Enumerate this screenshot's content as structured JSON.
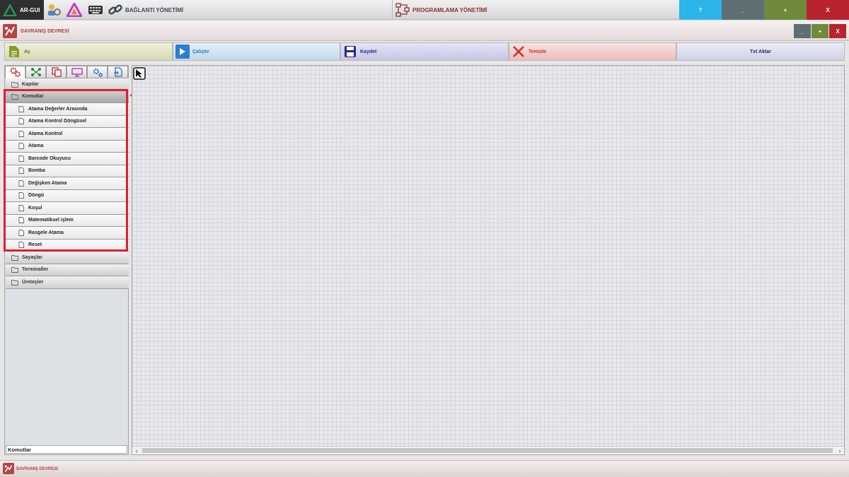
{
  "topbar": {
    "logo_text": "AR-GUI",
    "connection_label": "BAĞLANTI YÖNETİMİ",
    "programming_label": "PROGRAMLAMA YÖNETİMİ",
    "help_label": "?",
    "minimize_label": "_",
    "maximize_label": "+",
    "close_label": "X"
  },
  "subwindow": {
    "title": "DAVRANIŞ DEVRESİ",
    "minimize_label": "_",
    "maximize_label": "+",
    "close_label": "X"
  },
  "toolbar": {
    "open_label": "Aç",
    "run_label": "Çalıştır",
    "save_label": "Kaydet",
    "clear_label": "Temizle",
    "export_label": "Txt Aktar"
  },
  "tree": {
    "folders_before": [
      "Kapılar"
    ],
    "open_folder": "Komutlar",
    "items": [
      "Atama Değerler Arasında",
      "Atama Kontrol Döngüsel",
      "Atama Kontrol",
      "Atama",
      "Barcode Okuyucu",
      "Bomba",
      "Değişken Atama",
      "Döngü",
      "Koşul",
      "Matematiksel işlem",
      "Rasgele Atama",
      "Reset"
    ],
    "folders_after": [
      "Sayaçlar",
      "Terminaller",
      "Üreteçler"
    ]
  },
  "status_text": "Komutlar",
  "bottom": {
    "title": "DAVRANIŞ DEVRESİ"
  },
  "colors": {
    "help": "#2bb5e8",
    "minimize": "#5e6e72",
    "maximize": "#6f8a3c",
    "close": "#b8232e",
    "highlight": "#e01f2f"
  }
}
